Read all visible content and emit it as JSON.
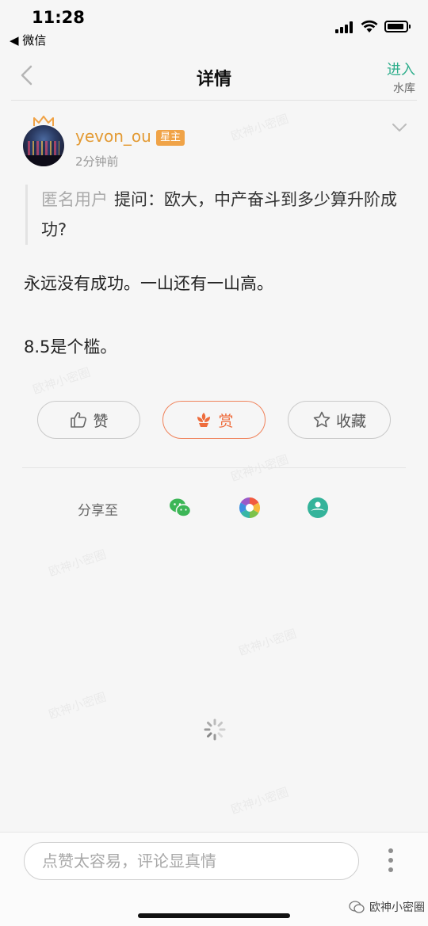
{
  "status_bar": {
    "time": "11:28",
    "back_app": "◀ 微信"
  },
  "nav": {
    "title": "详情",
    "enter_label": "进入",
    "enter_sub": "水库"
  },
  "post": {
    "username": "yevon_ou",
    "badge": "星主",
    "time": "2分钟前",
    "question_user": "匿名用户",
    "question_text": "提问：欧大，中产奋斗到多少算升阶成功?",
    "answer_line1": "永远没有成功。一山还有一山高。",
    "answer_line2": "8.5是个槛。"
  },
  "actions": {
    "like": "赞",
    "reward": "赏",
    "favorite": "收藏"
  },
  "share": {
    "label": "分享至",
    "targets": [
      "wechat-icon",
      "moments-icon",
      "qzone-icon"
    ]
  },
  "comment": {
    "placeholder": "点赞太容易，评论显真情"
  },
  "brand": {
    "label": "欧神小密圈"
  },
  "watermark": {
    "text": "欧神小密圈"
  },
  "colors": {
    "accent_green": "#2fae8c",
    "username_orange": "#e39a33",
    "badge_orange": "#f0a347",
    "reward_orange": "#ee6c3c"
  }
}
